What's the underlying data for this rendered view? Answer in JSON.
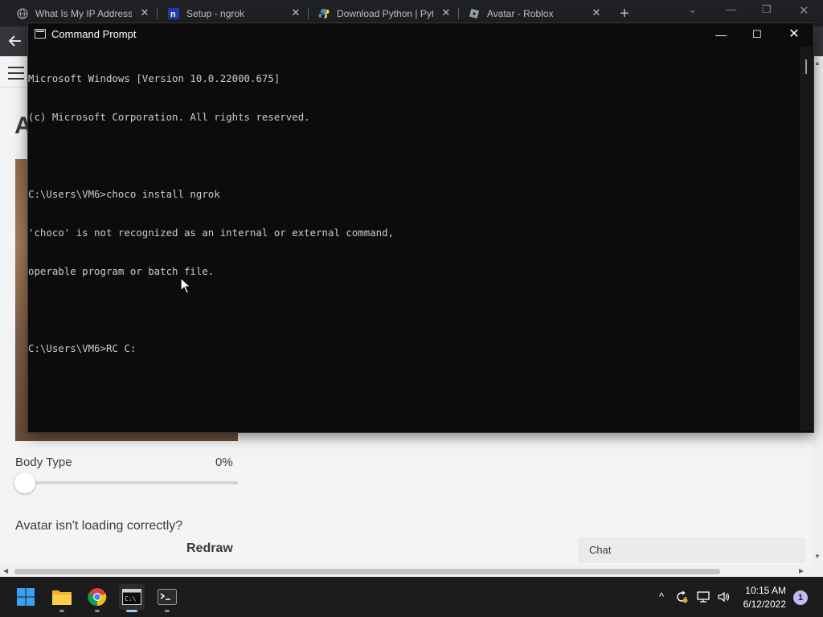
{
  "browser": {
    "tabs": [
      {
        "label": "What Is My IP Address",
        "icon": "globe-icon"
      },
      {
        "label": "Setup - ngrok",
        "icon": "ngrok-icon"
      },
      {
        "label": "Download Python | Pyt",
        "icon": "python-icon"
      },
      {
        "label": "Avatar - Roblox",
        "icon": "roblox-icon"
      }
    ],
    "new_tab_symbol": "+"
  },
  "page": {
    "title_partial": "A",
    "body_type_label": "Body Type",
    "body_type_value": "0%",
    "body_type_level": 0,
    "avatar_msg": "Avatar isn't loading correctly?",
    "redraw_label": "Redraw",
    "chat_label": "Chat"
  },
  "cmd": {
    "title": "Command Prompt",
    "lines": [
      "Microsoft Windows [Version 10.0.22000.675]",
      "(c) Microsoft Corporation. All rights reserved.",
      "",
      "C:\\Users\\VM6>choco install ngrok",
      "'choco' is not recognized as an internal or external command,",
      "operable program or batch file.",
      "",
      "C:\\Users\\VM6>RC C:"
    ]
  },
  "taskbar": {
    "apps": [
      {
        "name": "start-icon"
      },
      {
        "name": "file-explorer-icon"
      },
      {
        "name": "chrome-icon"
      },
      {
        "name": "command-prompt-icon"
      },
      {
        "name": "terminal-icon"
      }
    ],
    "time": "10:15 AM",
    "date": "6/12/2022",
    "notification_count": "1"
  },
  "colors": {
    "cmd_bg": "#0c0c0c",
    "cmd_text": "#cccccc",
    "tabbar_bg": "#202124",
    "taskbar_bg": "#1c1c1c"
  }
}
